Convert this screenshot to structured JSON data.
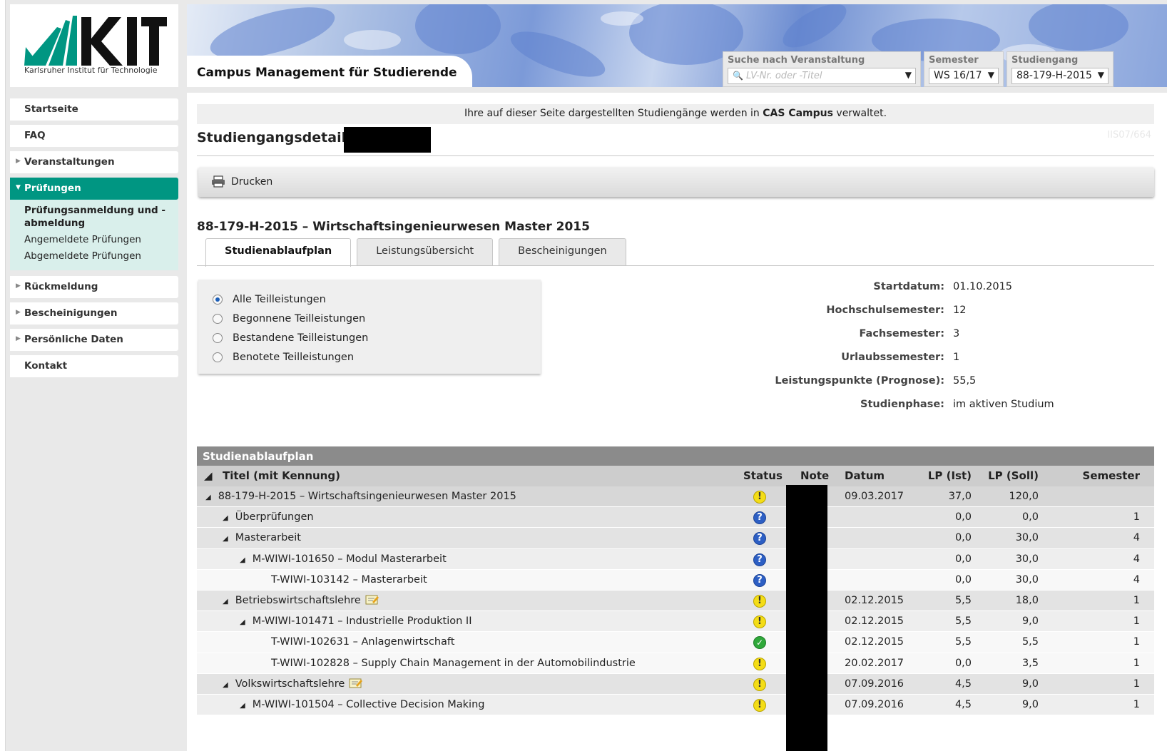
{
  "brand": {
    "logo_text": "KIT",
    "institute": "Karlsruher Institut für Technologie",
    "app_title": "Campus Management für Studierende",
    "accent_color": "#009682"
  },
  "header": {
    "search": {
      "label": "Suche nach Veranstaltung",
      "placeholder": "LV-Nr. oder -Titel"
    },
    "semester": {
      "label": "Semester",
      "value": "WS 16/17"
    },
    "program": {
      "label": "Studiengang",
      "value": "88-179-H-2015"
    }
  },
  "sidebar": {
    "items": [
      {
        "label": "Startseite"
      },
      {
        "label": "FAQ"
      },
      {
        "label": "Veranstaltungen"
      },
      {
        "label": "Prüfungen"
      },
      {
        "label": "Rückmeldung"
      },
      {
        "label": "Bescheinigungen"
      },
      {
        "label": "Persönliche Daten"
      },
      {
        "label": "Kontakt"
      }
    ],
    "sub_items": [
      {
        "label": "Prüfungsanmeldung und -abmeldung"
      },
      {
        "label": "Angemeldete Prüfungen"
      },
      {
        "label": "Abgemeldete Prüfungen"
      }
    ]
  },
  "main": {
    "info_text_pre": "Ihre auf dieser Seite dargestellten Studiengänge werden in ",
    "info_text_bold": "CAS Campus",
    "info_text_post": " verwaltet.",
    "page_title": "Studiengangsdetails",
    "page_id": "IIS07/664",
    "print_label": "Drucken",
    "program_title": "88-179-H-2015 – Wirtschaftsingenieurwesen Master 2015",
    "tabs": [
      {
        "label": "Studienablaufplan"
      },
      {
        "label": "Leistungsübersicht"
      },
      {
        "label": "Bescheinigungen"
      }
    ],
    "filters": [
      {
        "label": "Alle Teilleistungen"
      },
      {
        "label": "Begonnene Teilleistungen"
      },
      {
        "label": "Bestandene Teilleistungen"
      },
      {
        "label": "Benotete Teilleistungen"
      }
    ],
    "facts": [
      {
        "key": "Startdatum:",
        "value": "01.10.2015"
      },
      {
        "key": "Hochschulsemester:",
        "value": "12"
      },
      {
        "key": "Fachsemester:",
        "value": "3"
      },
      {
        "key": "Urlaubssemester:",
        "value": "1"
      },
      {
        "key": "Leistungspunkte (Prognose):",
        "value": "55,5"
      },
      {
        "key": "Studienphase:",
        "value": "im aktiven Studium"
      }
    ]
  },
  "plan": {
    "heading": "Studienablaufplan",
    "columns": {
      "title": "Titel (mit Kennung)",
      "status": "Status",
      "note": "Note",
      "datum": "Datum",
      "lp_ist": "LP (Ist)",
      "lp_soll": "LP (Soll)",
      "semester": "Semester"
    },
    "status_glyphs": {
      "warn": "!",
      "unknown": "?",
      "ok": "✓"
    },
    "rows": [
      {
        "title": "88-179-H-2015 – Wirtschaftsingenieurwesen Master 2015",
        "status": "warn",
        "datum": "09.03.2017",
        "lp_ist": "37,0",
        "lp_soll": "120,0",
        "semester": ""
      },
      {
        "title": "Überprüfungen",
        "status": "unknown",
        "datum": "",
        "lp_ist": "0,0",
        "lp_soll": "0,0",
        "semester": "1"
      },
      {
        "title": "Masterarbeit",
        "status": "unknown",
        "datum": "",
        "lp_ist": "0,0",
        "lp_soll": "30,0",
        "semester": "4"
      },
      {
        "title": "M-WIWI-101650 – Modul Masterarbeit",
        "status": "unknown",
        "datum": "",
        "lp_ist": "0,0",
        "lp_soll": "30,0",
        "semester": "4"
      },
      {
        "title": "T-WIWI-103142 – Masterarbeit",
        "status": "unknown",
        "datum": "",
        "lp_ist": "0,0",
        "lp_soll": "30,0",
        "semester": "4"
      },
      {
        "title": "Betriebswirtschaftslehre",
        "status": "warn",
        "datum": "02.12.2015",
        "lp_ist": "5,5",
        "lp_soll": "18,0",
        "semester": "1"
      },
      {
        "title": "M-WIWI-101471 – Industrielle Produktion II",
        "status": "warn",
        "datum": "02.12.2015",
        "lp_ist": "5,5",
        "lp_soll": "9,0",
        "semester": "1"
      },
      {
        "title": "T-WIWI-102631 – Anlagenwirtschaft",
        "status": "ok",
        "datum": "02.12.2015",
        "lp_ist": "5,5",
        "lp_soll": "5,5",
        "semester": "1"
      },
      {
        "title": "T-WIWI-102828 – Supply Chain Management in der Automobilindustrie",
        "status": "warn",
        "datum": "20.02.2017",
        "lp_ist": "0,0",
        "lp_soll": "3,5",
        "semester": "1"
      },
      {
        "title": "Volkswirtschaftslehre",
        "status": "warn",
        "datum": "07.09.2016",
        "lp_ist": "4,5",
        "lp_soll": "9,0",
        "semester": "1"
      },
      {
        "title": "M-WIWI-101504 – Collective Decision Making",
        "status": "warn",
        "datum": "07.09.2016",
        "lp_ist": "4,5",
        "lp_soll": "9,0",
        "semester": "1"
      }
    ]
  }
}
